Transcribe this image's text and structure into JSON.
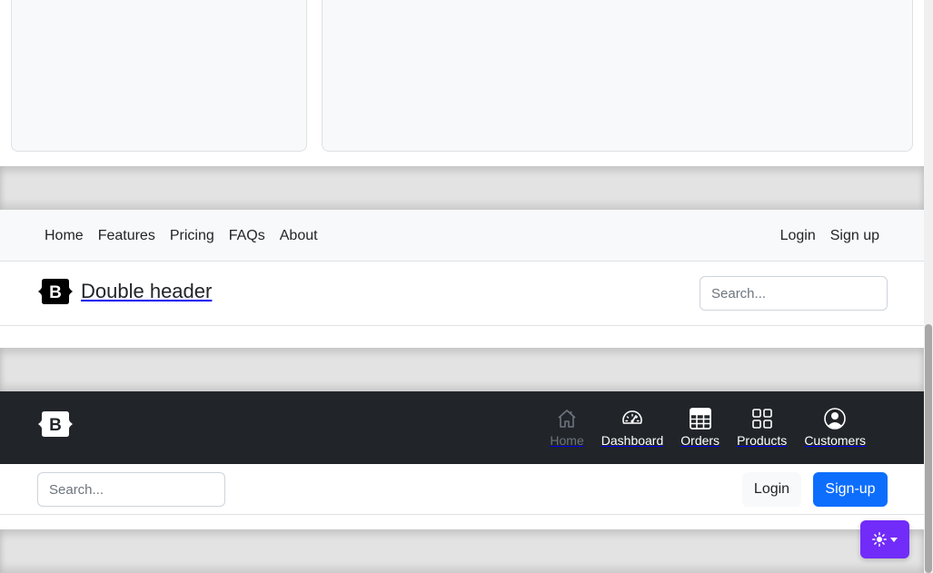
{
  "double_header": {
    "nav_links": [
      "Home",
      "Features",
      "Pricing",
      "FAQs",
      "About"
    ],
    "auth_links": [
      "Login",
      "Sign up"
    ],
    "brand_title": "Double header",
    "search_placeholder": "Search..."
  },
  "dark_header": {
    "nav_items": [
      {
        "label": "Home",
        "icon": "house-icon",
        "active": false
      },
      {
        "label": "Dashboard",
        "icon": "speedometer-icon",
        "active": true
      },
      {
        "label": "Orders",
        "icon": "table-icon",
        "active": true
      },
      {
        "label": "Products",
        "icon": "grid-icon",
        "active": true
      },
      {
        "label": "Customers",
        "icon": "person-circle-icon",
        "active": true
      }
    ],
    "search_placeholder": "Search...",
    "login_label": "Login",
    "signup_label": "Sign-up"
  },
  "colors": {
    "primary": "#0d6efd",
    "dark": "#212529",
    "theme_toggle": "#712cf9"
  }
}
